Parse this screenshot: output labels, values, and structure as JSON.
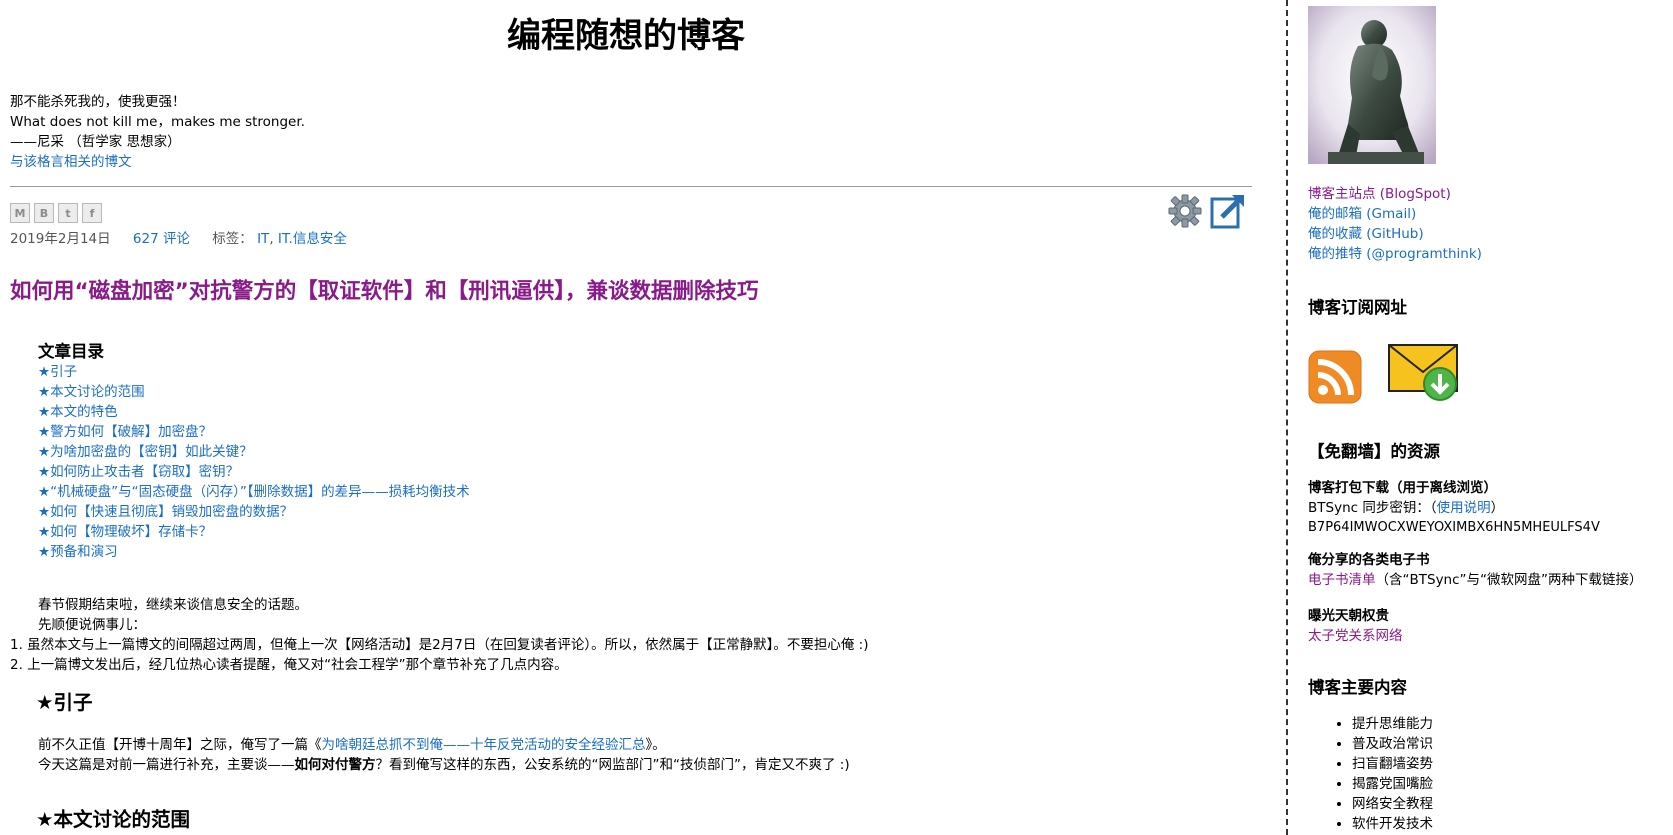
{
  "blog": {
    "title": "编程随想的博客",
    "quote_line1": "那不能杀死我的，使我更强！",
    "quote_line2": "What does not kill me，makes me stronger.",
    "quote_line3": "——尼采 （哲学家 思想家）",
    "quote_link": "与该格言相关的博文"
  },
  "share": {
    "email_label": "M",
    "blog_label": "B",
    "twitter_label": "t",
    "facebook_label": "f"
  },
  "post": {
    "date": "2019年2月14日",
    "comments": "627 评论",
    "labels_prefix": "标签：",
    "label_1": "IT",
    "label_sep": ", ",
    "label_2": "IT.信息安全",
    "title": "如何用“磁盘加密”对抗警方的【取证软件】和【刑讯逼供】，兼谈数据删除技巧",
    "toc_title": "文章目录",
    "toc": [
      "★引子",
      "★本文讨论的范围",
      "★本文的特色",
      "★警方如何【破解】加密盘？",
      "★为啥加密盘的【密钥】如此关键？",
      "★如何防止攻击者【窃取】密钥？",
      "★“机械硬盘”与“固态硬盘（闪存）”【删除数据】的差异——损耗均衡技术",
      "★如何【快速且彻底】销毁加密盘的数据？",
      "★如何【物理破坏】存储卡？",
      "★预备和演习"
    ],
    "intro_p1": "春节假期结束啦，继续来谈信息安全的话题。",
    "intro_p2": "先顺便说俩事儿：",
    "list_1": "1. 虽然本文与上一篇博文的间隔超过两周，但俺上一次【网络活动】是2月7日（在回复读者评论）。所以，依然属于【正常静默】。不要担心俺 :)",
    "list_2": "2. 上一篇博文发出后，经几位热心读者提醒，俺又对“社会工程学”那个章节补充了几点内容。",
    "section1_title": "★引子",
    "s1_p1_a": "前不久正值【开博十周年】之际，俺写了一篇《",
    "s1_p1_link": "为啥朝廷总抓不到俺——十年反党活动的安全经验汇总",
    "s1_p1_b": "》。",
    "s1_p2_a": "今天这篇是对前一篇进行补充，主要谈——",
    "s1_p2_bold": "如何对付警方",
    "s1_p2_b": "？看到俺写这样的东西，公安系统的“网监部门”和“技侦部门”，肯定又不爽了 :)",
    "section2_title": "★本文讨论的范围"
  },
  "sidebar": {
    "profile_link_1": "博客主站点 (BlogSpot)",
    "profile_link_2": "俺的邮箱 (Gmail)",
    "profile_link_3": "俺的收藏 (GitHub)",
    "profile_link_4": "俺的推特 (@programthink)",
    "subscribe_title": "博客订阅网址",
    "resources_title": "【免翻墙】的资源",
    "offline_title": "博客打包下载（用于离线浏览）",
    "btsync_prefix": "BTSync 同步密钥：（",
    "btsync_link": "使用说明",
    "btsync_suffix": "）",
    "btsync_key": "B7P64IMWOCXWEYOXIMBX6HN5MHEULFS4V",
    "ebook_title": "俺分享的各类电子书",
    "ebook_link": "电子书清单",
    "ebook_note": "（含“BTSync”与“微软网盘”两种下载链接）",
    "expose_title": "曝光天朝权贵",
    "expose_link": "太子党关系网络",
    "main_topics_title": "博客主要内容",
    "topics": [
      "提升思维能力",
      "普及政治常识",
      "扫盲翻墙姿势",
      "揭露党国嘴脸",
      "网络安全教程",
      "软件开发技术"
    ]
  },
  "colors": {
    "link": "#1a6fc4",
    "visited": "#8a1a8a",
    "rss": "#f08a24",
    "email_icon": "#f6c21e"
  }
}
